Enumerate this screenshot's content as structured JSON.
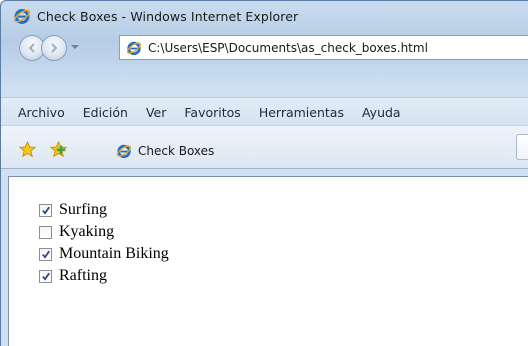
{
  "window": {
    "title": "Check Boxes - Windows Internet Explorer"
  },
  "address_bar": {
    "url": "C:\\Users\\ESP\\Documents\\as_check_boxes.html"
  },
  "menu": [
    "Archivo",
    "Edición",
    "Ver",
    "Favoritos",
    "Herramientas",
    "Ayuda"
  ],
  "tab": {
    "label": "Check Boxes"
  },
  "checkboxes": [
    {
      "label": "Surfing",
      "checked": true
    },
    {
      "label": "Kyaking",
      "checked": false
    },
    {
      "label": "Mountain Biking",
      "checked": true
    },
    {
      "label": "Rafting",
      "checked": true
    }
  ],
  "icons": {
    "browser": "ie-logo-icon",
    "back": "back-arrow-icon",
    "forward": "forward-arrow-icon",
    "favorites": "favorites-star-icon",
    "add_favorites": "add-to-favorites-icon",
    "checkmark": "checkmark-icon"
  },
  "colors": {
    "ie_blue": "#1e6fc7",
    "ie_orange": "#f0a21a",
    "star_yellow": "#f5c518",
    "check_blue": "#2b4a8c"
  }
}
